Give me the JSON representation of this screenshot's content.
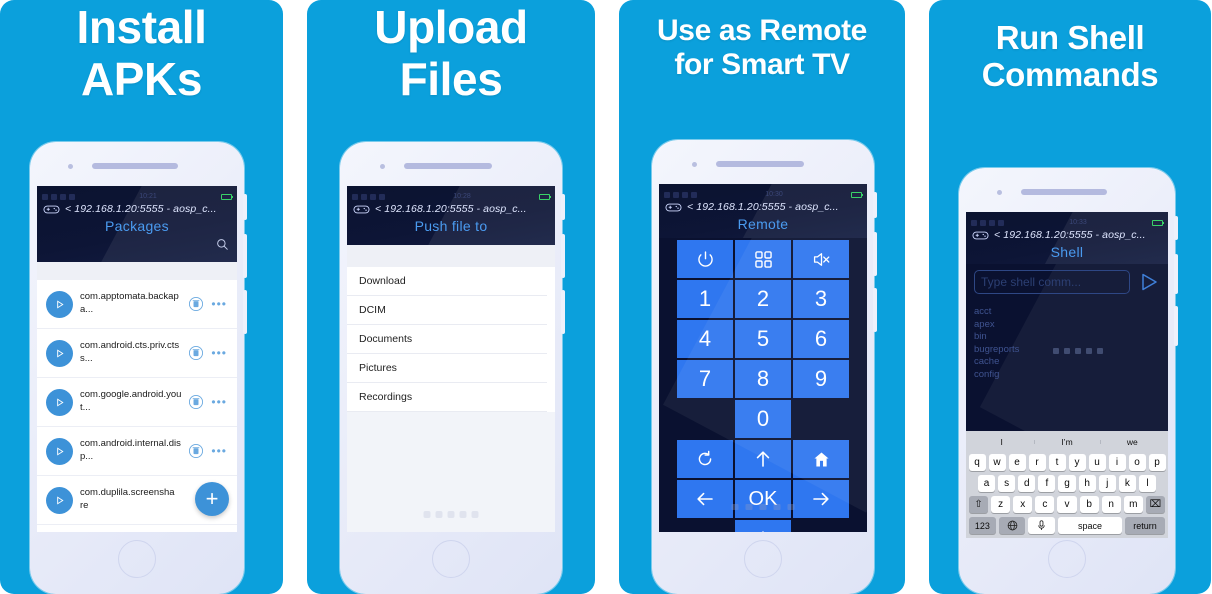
{
  "theme": {
    "brand_blue": "#0BA0DC",
    "accent_blue": "#3d92d8",
    "remote_key": "#2f77f0",
    "dark_screen": "#0a1130",
    "title_blue": "#4a9bf0"
  },
  "panels": [
    {
      "headline": "Install\nAPKs",
      "headline_line1": "Install",
      "headline_line2": "APKs",
      "app": {
        "address": "< 192.168.1.20:5555 - aosp_c...",
        "title": "Packages",
        "status_time": "10:21"
      },
      "packages": [
        {
          "name": "com.apptomata.backapa...",
          "play": "play-icon",
          "delete": "trash-icon",
          "more": "•••"
        },
        {
          "name": "com.android.cts.priv.ctss...",
          "play": "play-icon",
          "delete": "trash-icon",
          "more": "•••"
        },
        {
          "name": "com.google.android.yout...",
          "play": "play-icon",
          "delete": "trash-icon",
          "more": "•••"
        },
        {
          "name": "com.android.internal.disp...",
          "play": "play-icon",
          "delete": "trash-icon",
          "more": "•••"
        },
        {
          "name": "com.duplila.screenshare",
          "play": "play-icon",
          "delete": "trash-icon",
          "more": "•••"
        }
      ],
      "fab_label": "+"
    },
    {
      "headline_line1": "Upload",
      "headline_line2": "Files",
      "app": {
        "address": "< 192.168.1.20:5555 - aosp_c...",
        "title": "Push file to",
        "status_time": "10:28"
      },
      "folders": [
        "Download",
        "DCIM",
        "Documents",
        "Pictures",
        "Recordings"
      ]
    },
    {
      "headline_line1": "Use as Remote",
      "headline_line2": "for Smart TV",
      "app": {
        "address": "< 192.168.1.20:5555 - aosp_c...",
        "title": "Remote",
        "status_time": "10:30"
      },
      "remote_keys": [
        {
          "label": "",
          "icon": "power-icon"
        },
        {
          "label": "",
          "icon": "apps-grid-icon"
        },
        {
          "label": "",
          "icon": "mute-icon"
        },
        {
          "label": "1",
          "icon": ""
        },
        {
          "label": "2",
          "icon": ""
        },
        {
          "label": "3",
          "icon": ""
        },
        {
          "label": "4",
          "icon": ""
        },
        {
          "label": "5",
          "icon": ""
        },
        {
          "label": "6",
          "icon": ""
        },
        {
          "label": "7",
          "icon": ""
        },
        {
          "label": "8",
          "icon": ""
        },
        {
          "label": "9",
          "icon": ""
        },
        {
          "label": "",
          "icon": "blank"
        },
        {
          "label": "0",
          "icon": ""
        },
        {
          "label": "",
          "icon": "blank"
        },
        {
          "label": "",
          "icon": "back-refresh-icon"
        },
        {
          "label": "",
          "icon": "arrow-up-icon"
        },
        {
          "label": "",
          "icon": "home-icon"
        },
        {
          "label": "",
          "icon": "arrow-left-icon"
        },
        {
          "label": "OK",
          "icon": ""
        },
        {
          "label": "",
          "icon": "arrow-right-icon"
        }
      ]
    },
    {
      "headline_line1": "Run Shell",
      "headline_line2": "Commands",
      "app": {
        "address": "< 192.168.1.20:5555 - aosp_c...",
        "title": "Shell",
        "status_time": "10:33"
      },
      "shell": {
        "input_placeholder": "Type shell comm...",
        "send_icon": "send-triangle-icon",
        "output": [
          "acct",
          "apex",
          "bin",
          "bugreports",
          "cache",
          "config"
        ]
      },
      "keyboard": {
        "predictions": [
          "I",
          "I’m",
          "we"
        ],
        "row1": [
          "q",
          "w",
          "e",
          "r",
          "t",
          "y",
          "u",
          "i",
          "o",
          "p"
        ],
        "row2": [
          "a",
          "s",
          "d",
          "f",
          "g",
          "h",
          "j",
          "k",
          "l"
        ],
        "row3_shift": "⇧",
        "row3": [
          "z",
          "x",
          "c",
          "v",
          "b",
          "n",
          "m"
        ],
        "row3_backspace": "⌧",
        "numeric_key": "123",
        "globe_key": "globe-icon",
        "mic_key": "mic-icon",
        "space_key": "space",
        "return_key": "return"
      }
    }
  ]
}
